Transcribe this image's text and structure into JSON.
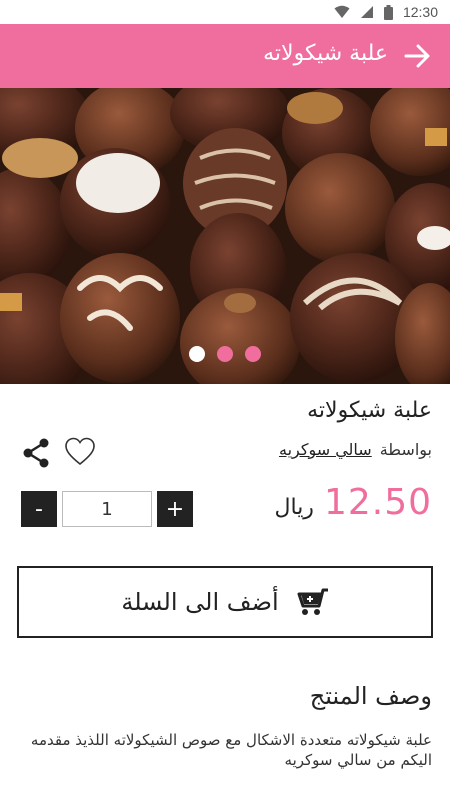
{
  "status_bar": {
    "time": "12:30",
    "icons": [
      "wifi-icon",
      "signal-icon",
      "battery-icon"
    ]
  },
  "app_bar": {
    "title": "علبة شيكولاته",
    "back_icon": "arrow-right-icon",
    "color": "#f06e9e"
  },
  "carousel": {
    "slide_count": 3,
    "active_index": 0,
    "image": "chocolate-truffles-photo"
  },
  "product": {
    "title": "علبة شيكولاته",
    "by_label": "بواسطة",
    "seller": "سالي سوكريه",
    "price": "12.50",
    "currency": "ريال",
    "quantity": "1",
    "minus_label": "-",
    "plus_label": "+",
    "add_to_cart_label": "أضف الى السلة",
    "cart_icon": "cart-icon",
    "share_icon": "share-icon",
    "favorite_icon": "heart-icon"
  },
  "description": {
    "title": "وصف المنتج",
    "text": "علبة شيكولاته متعددة الاشكال مع صوص الشيكولاته اللذيذ مقدمه اليكم من سالي سوكريه"
  },
  "colors": {
    "accent": "#f06e9e",
    "dark": "#222222"
  }
}
